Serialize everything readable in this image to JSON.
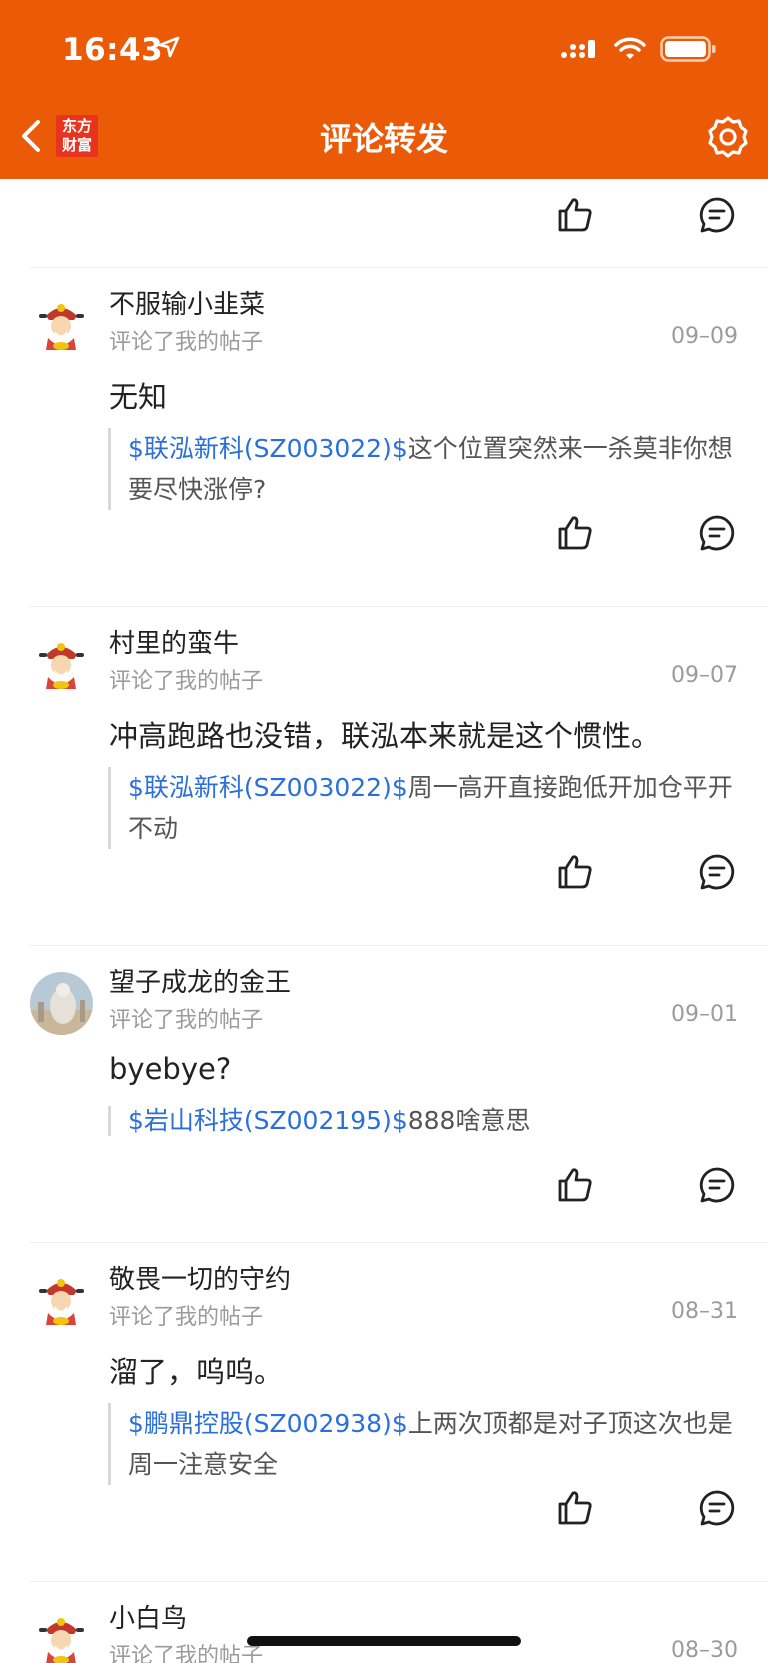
{
  "status_bar": {
    "time": "16:43"
  },
  "header": {
    "logo_text": "东方\n财富",
    "title": "评论转发"
  },
  "items": [
    {
      "username": "不服输小韭菜",
      "subtitle": "评论了我的帖子",
      "date": "09–09",
      "comment": "无知",
      "quote_stock": "$联泓新科(SZ003022)$",
      "quote_text": "这个位置突然来一杀莫非你想要尽快涨停?",
      "avatar": "caishen"
    },
    {
      "username": "村里的蛮牛",
      "subtitle": "评论了我的帖子",
      "date": "09–07",
      "comment": "冲高跑路也没错，联泓本来就是这个惯性。",
      "quote_stock": "$联泓新科(SZ003022)$",
      "quote_text": "周一高开直接跑低开加仓平开不动",
      "avatar": "caishen"
    },
    {
      "username": "望子成龙的金王",
      "subtitle": "评论了我的帖子",
      "date": "09–01",
      "comment": "byebye?",
      "quote_stock": "$岩山科技(SZ002195)$",
      "quote_text": "888啥意思",
      "avatar": "statue"
    },
    {
      "username": "敬畏一切的守约",
      "subtitle": "评论了我的帖子",
      "date": "08–31",
      "comment": "溜了，呜呜。",
      "quote_stock": "$鹏鼎控股(SZ002938)$",
      "quote_text": "上两次顶都是对子顶这次也是周一注意安全",
      "avatar": "caishen"
    },
    {
      "username": "小白鸟",
      "subtitle": "评论了我的帖子",
      "date": "08–30",
      "avatar": "caishen"
    }
  ],
  "colors": {
    "header_bg": "#EB5A06",
    "stock_link": "#2A6FDB",
    "logo_bg": "#E8331E"
  },
  "icons": [
    "back-chevron-icon",
    "settings-gear-icon",
    "thumbs-up-icon",
    "comment-bubble-icon",
    "location-arrow-icon",
    "signal-icon",
    "wifi-icon",
    "battery-icon"
  ]
}
